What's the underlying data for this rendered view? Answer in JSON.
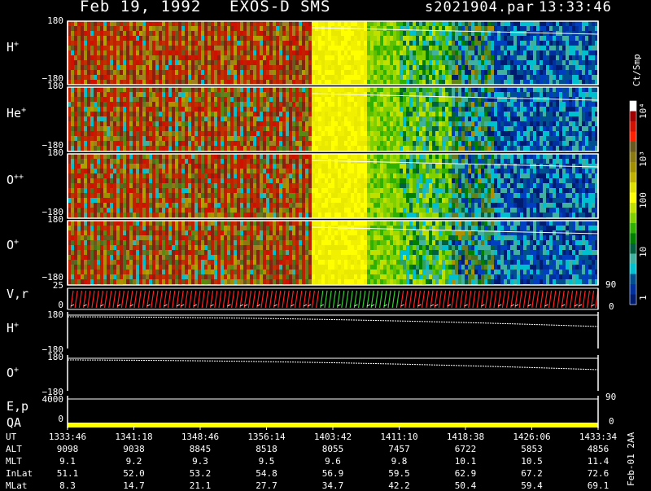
{
  "header": {
    "date": "Feb 19, 1992",
    "instrument": "EXOS-D SMS",
    "file": "s2021904.par",
    "time": "13:33:46"
  },
  "panels": [
    {
      "label": "H",
      "sup": "+",
      "ytop": "180",
      "ybot": "−180"
    },
    {
      "label": "He",
      "sup": "+",
      "ytop": "180",
      "ybot": "−180"
    },
    {
      "label": "O",
      "sup": "++",
      "ytop": "180",
      "ybot": "−180"
    },
    {
      "label": "O",
      "sup": "+",
      "ytop": "180",
      "ybot": "−180"
    }
  ],
  "vr": {
    "label": "V,r",
    "ytop": "25",
    "ybot": "0",
    "right_top": "90",
    "right_bot": "0"
  },
  "h_line": {
    "label": "H",
    "sup": "+",
    "ytop": "180",
    "ybot": "−180"
  },
  "o_line": {
    "label": "O",
    "sup": "+",
    "ytop": "180",
    "ybot": "−180"
  },
  "ep": {
    "label": "E,p",
    "ytop": "4000",
    "right": "90"
  },
  "qa": {
    "label": "QA",
    "ybot": "0",
    "right": "0"
  },
  "colorbar": {
    "title": "Ct/Smp",
    "ticks": [
      "10⁴",
      "10³",
      "100",
      "10",
      "1"
    ],
    "colors": [
      "#ffffff",
      "#a00000",
      "#d01000",
      "#ff2000",
      "#6a5a20",
      "#8a7a10",
      "#a09000",
      "#c0b000",
      "#e0e000",
      "#ffff00",
      "#c0e000",
      "#80d000",
      "#30b000",
      "#008000",
      "#006040",
      "#40b0a0",
      "#00c0d0",
      "#005090",
      "#0030a0",
      "#001c70"
    ]
  },
  "footer_stamp": "Feb-01 2AA",
  "chart_data": {
    "type": "heatmap",
    "title": "Feb 19, 1992   EXOS-D SMS",
    "x_axis": {
      "label": "UT",
      "ticks": [
        "1333:46",
        "1341:18",
        "1348:46",
        "1356:14",
        "1403:42",
        "1411:10",
        "1418:38",
        "1426:06",
        "1433:34"
      ]
    },
    "panels": [
      "H+",
      "He+",
      "O++",
      "O+"
    ],
    "y_range": [
      -180,
      180
    ],
    "colorbar_range_log": [
      1,
      10000
    ],
    "colorbar_label": "Ct/Smp",
    "orbit_table": {
      "rows": [
        {
          "name": "UT",
          "values": [
            "1333:46",
            "1341:18",
            "1348:46",
            "1356:14",
            "1403:42",
            "1411:10",
            "1418:38",
            "1426:06",
            "1433:34"
          ]
        },
        {
          "name": "ALT",
          "values": [
            "9098",
            "9038",
            "8845",
            "8518",
            "8055",
            "7457",
            "6722",
            "5853",
            "4856"
          ]
        },
        {
          "name": "MLT",
          "values": [
            "9.1",
            "9.2",
            "9.3",
            "9.5",
            "9.6",
            "9.8",
            "10.1",
            "10.5",
            "11.4"
          ]
        },
        {
          "name": "InLat",
          "values": [
            "51.1",
            "52.0",
            "53.2",
            "54.8",
            "56.9",
            "59.5",
            "62.9",
            "67.2",
            "72.6"
          ]
        },
        {
          "name": "MLat",
          "values": [
            "8.3",
            "14.7",
            "21.1",
            "27.7",
            "34.7",
            "42.2",
            "50.4",
            "59.4",
            "69.1"
          ]
        }
      ]
    }
  }
}
